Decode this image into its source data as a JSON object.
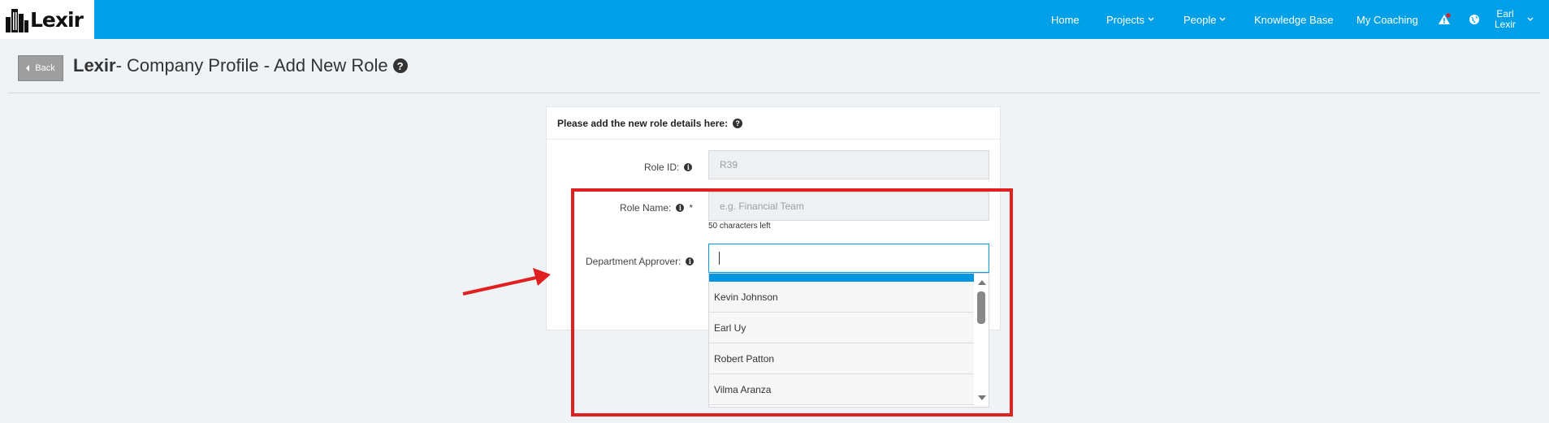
{
  "header": {
    "logo_text": "Lexir",
    "nav": [
      {
        "label": "Home",
        "has_dropdown": false
      },
      {
        "label": "Projects",
        "has_dropdown": true
      },
      {
        "label": "People",
        "has_dropdown": true
      },
      {
        "label": "Knowledge Base",
        "has_dropdown": false
      },
      {
        "label": "My Coaching",
        "has_dropdown": false
      }
    ],
    "user": {
      "first": "Earl",
      "last": "Lexir"
    },
    "colors": {
      "bar": "#00a0e9",
      "notification_dot": "#e02020"
    }
  },
  "page": {
    "back_label": "Back",
    "title_bold": "Lexir",
    "title_rest": "- Company Profile - Add New Role"
  },
  "form": {
    "heading": "Please add the new role details here:",
    "role_id": {
      "label": "Role ID:",
      "value": "R39"
    },
    "role_name": {
      "label": "Role Name:",
      "required_mark": "*",
      "placeholder": "e.g. Financial Team",
      "hint": "50 characters left"
    },
    "department_approver": {
      "label": "Department Approver:",
      "search_value": "",
      "options": [
        "Kevin Johnson",
        "Earl Uy",
        "Robert Patton",
        "Vilma Aranza"
      ]
    }
  },
  "annotation": {
    "color": "#e02020"
  }
}
